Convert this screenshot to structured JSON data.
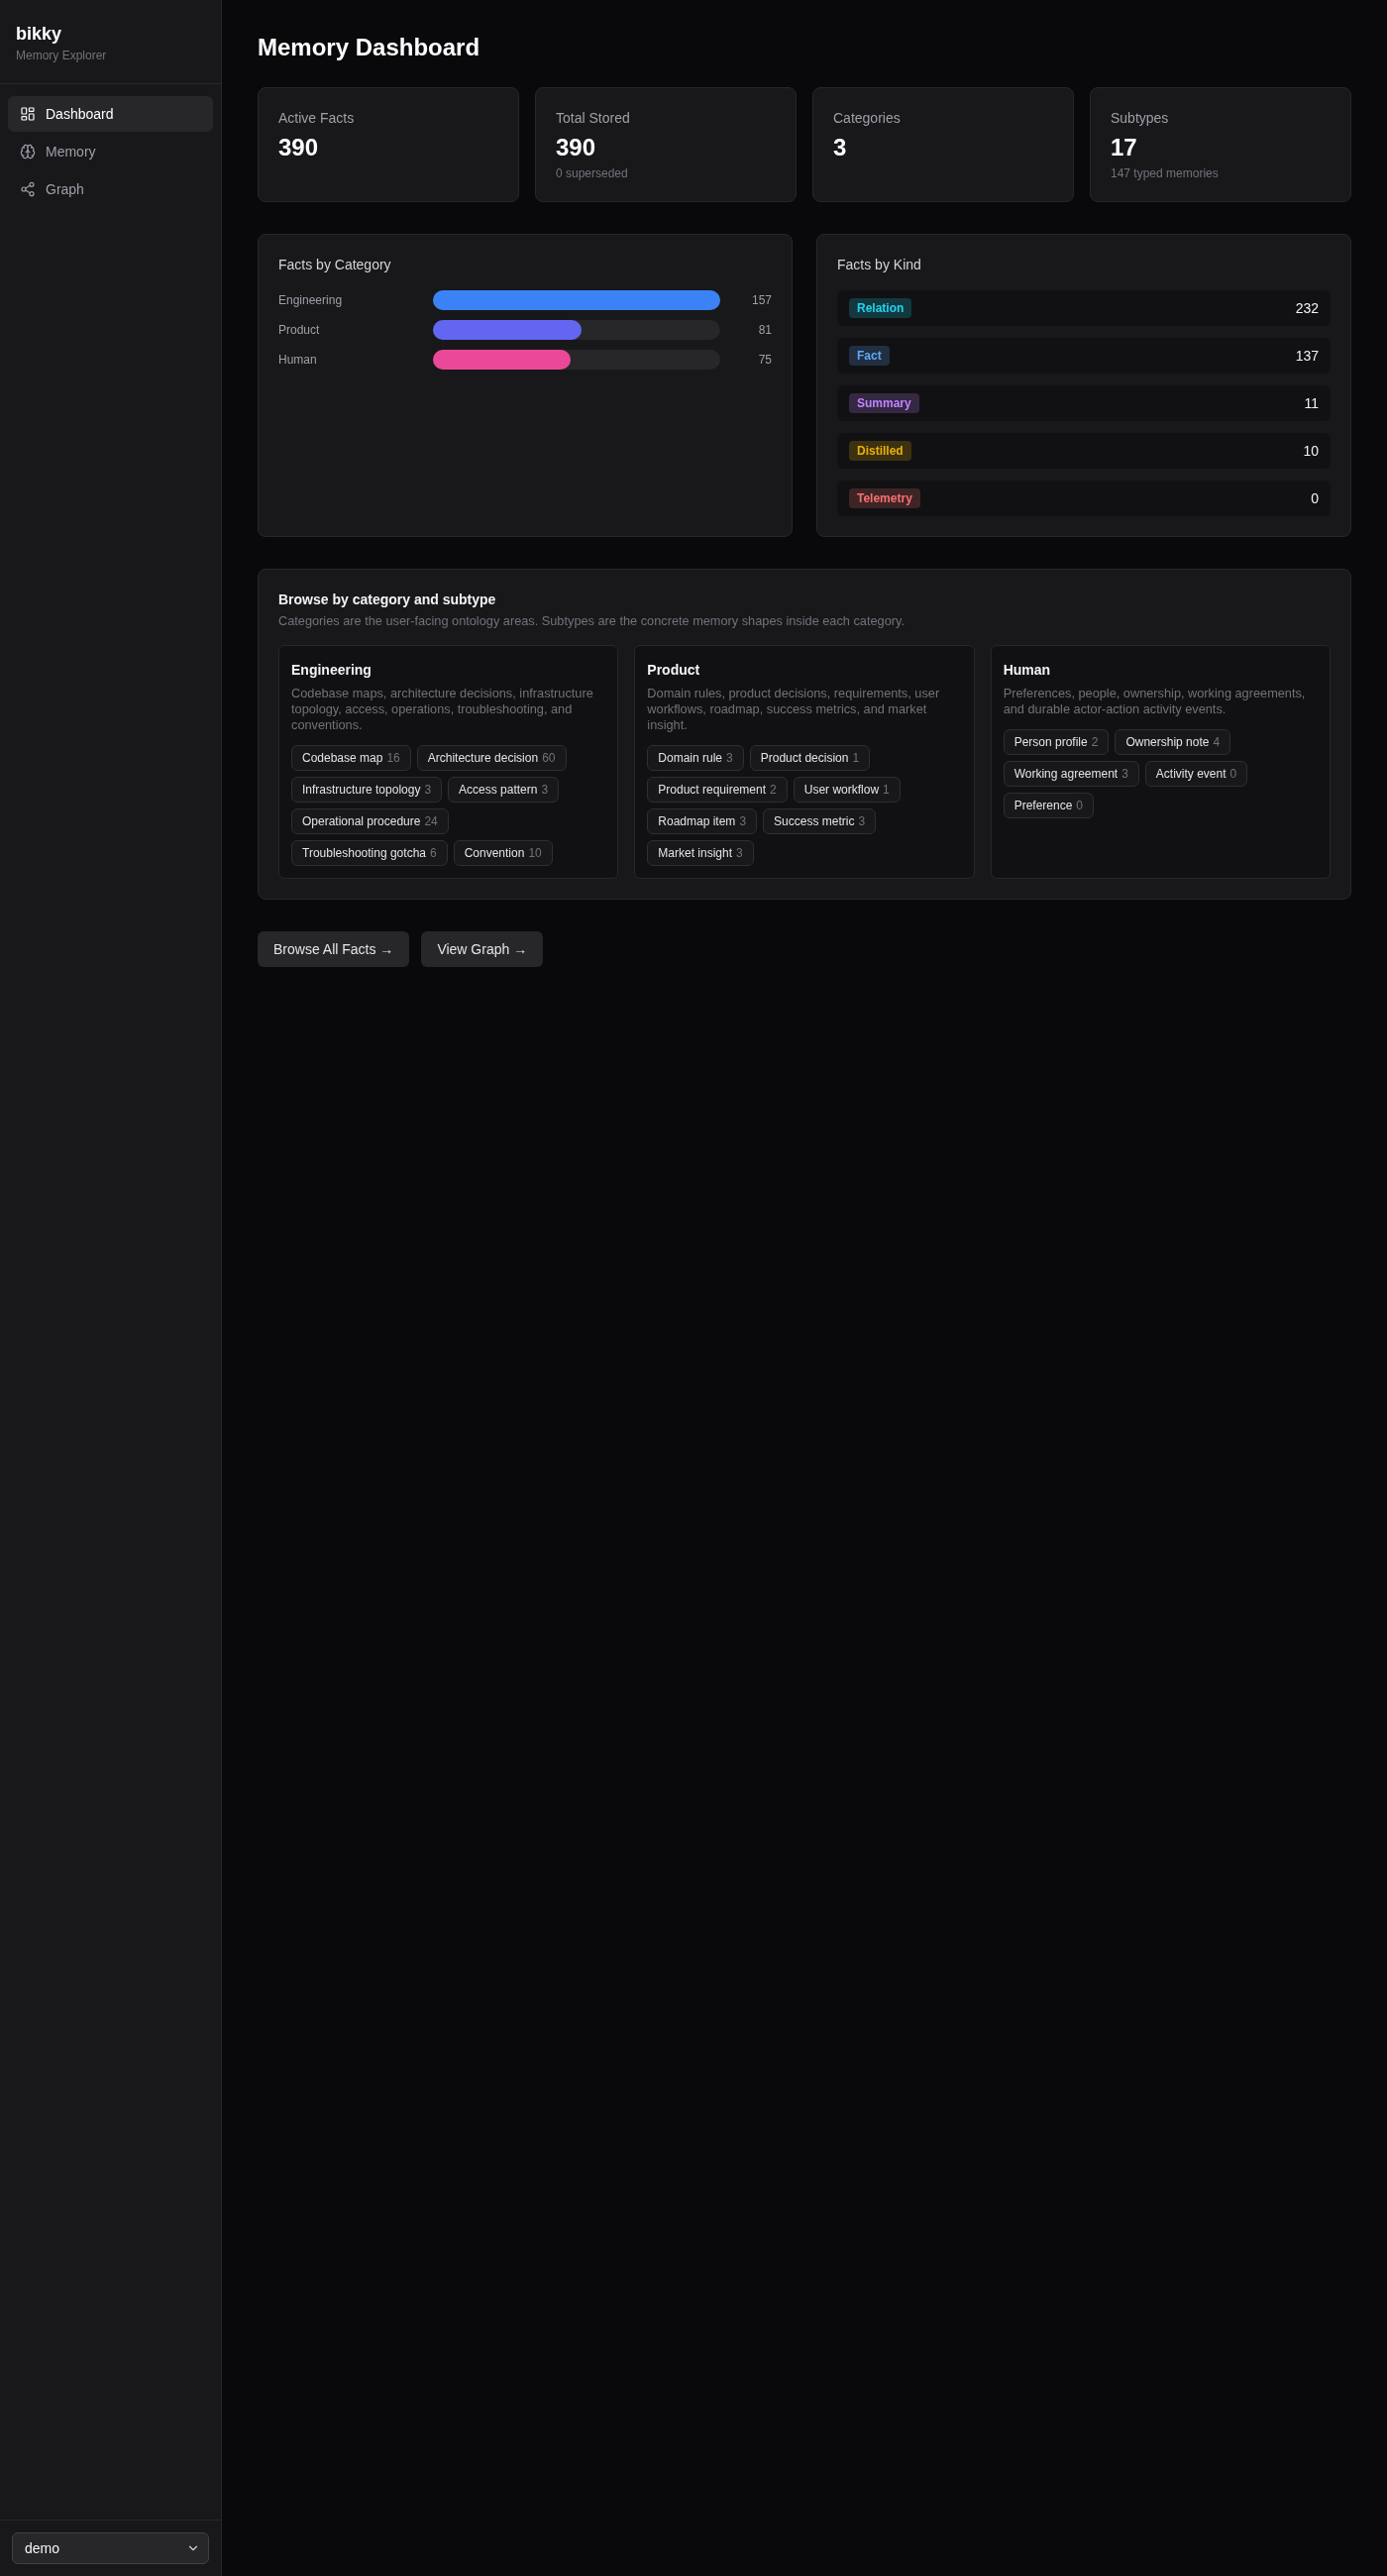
{
  "sidebar": {
    "brand": "bikky",
    "subtitle": "Memory Explorer",
    "nav": [
      {
        "label": "Dashboard",
        "selected": true
      },
      {
        "label": "Memory",
        "selected": false
      },
      {
        "label": "Graph",
        "selected": false
      }
    ],
    "workspace_select": {
      "value": "demo"
    }
  },
  "page_title": "Memory Dashboard",
  "stats": [
    {
      "label": "Active Facts",
      "value": "390"
    },
    {
      "label": "Total Stored",
      "value": "390",
      "note": "0 superseded"
    },
    {
      "label": "Categories",
      "value": "3"
    },
    {
      "label": "Subtypes",
      "value": "17",
      "note": "147 typed memories"
    }
  ],
  "facts_by_category": {
    "title": "Facts by Category",
    "items": [
      {
        "label": "Engineering",
        "count": "157",
        "level": 1,
        "color": "#3b82f6"
      },
      {
        "label": "Product",
        "count": "81",
        "level": 0.516,
        "color": "#6366f1"
      },
      {
        "label": "Human",
        "count": "75",
        "level": 0.478,
        "color": "#ec4899"
      }
    ]
  },
  "facts_by_kind": {
    "title": "Facts by Kind",
    "items": [
      {
        "label": "Relation",
        "count": "232",
        "color": "#14383f"
      },
      {
        "label": "Fact",
        "count": "137",
        "color": "#212f41"
      },
      {
        "label": "Summary",
        "count": "11",
        "color": "#342842"
      },
      {
        "label": "Distilled",
        "count": "10",
        "color": "#3c3111"
      },
      {
        "label": "Telemetry",
        "count": "0",
        "color": "#3f2426"
      }
    ]
  },
  "browse": {
    "title": "Browse by category and subtype",
    "description": "Categories are the user-facing ontology areas. Subtypes are the concrete memory shapes inside each category.",
    "categories": [
      {
        "name": "Engineering",
        "description": "Codebase maps, architecture decisions, infrastructure topology, access, operations, troubleshooting, and conventions.",
        "subtypes": [
          {
            "label": "Codebase map",
            "count": "16"
          },
          {
            "label": "Architecture decision",
            "count": "60"
          },
          {
            "label": "Infrastructure topology",
            "count": "3"
          },
          {
            "label": "Access pattern",
            "count": "3"
          },
          {
            "label": "Operational procedure",
            "count": "24"
          },
          {
            "label": "Troubleshooting gotcha",
            "count": "6"
          },
          {
            "label": "Convention",
            "count": "10"
          }
        ]
      },
      {
        "name": "Product",
        "description": "Domain rules, product decisions, requirements, user workflows, roadmap, success metrics, and market insight.",
        "subtypes": [
          {
            "label": "Domain rule",
            "count": "3"
          },
          {
            "label": "Product decision",
            "count": "1"
          },
          {
            "label": "Product requirement",
            "count": "2"
          },
          {
            "label": "User workflow",
            "count": "1"
          },
          {
            "label": "Roadmap item",
            "count": "3"
          },
          {
            "label": "Success metric",
            "count": "3"
          },
          {
            "label": "Market insight",
            "count": "3"
          }
        ]
      },
      {
        "name": "Human",
        "description": "Preferences, people, ownership, working agreements, and durable actor-action activity events.",
        "subtypes": [
          {
            "label": "Person profile",
            "count": "2"
          },
          {
            "label": "Ownership note",
            "count": "4"
          },
          {
            "label": "Working agreement",
            "count": "3"
          },
          {
            "label": "Activity event",
            "count": "0"
          },
          {
            "label": "Preference",
            "count": "0"
          }
        ]
      }
    ]
  },
  "actions": [
    {
      "label": "Browse All Facts →"
    },
    {
      "label": "View Graph →"
    }
  ]
}
